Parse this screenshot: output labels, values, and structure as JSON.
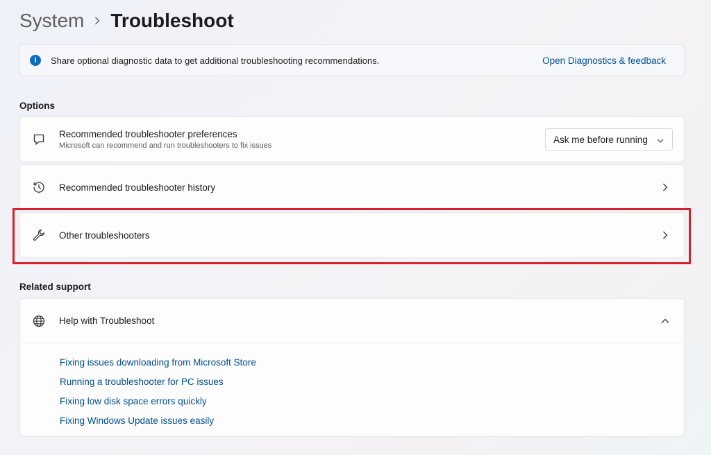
{
  "breadcrumb": {
    "parent": "System",
    "current": "Troubleshoot"
  },
  "info": {
    "text": "Share optional diagnostic data to get additional troubleshooting recommendations.",
    "link": "Open Diagnostics & feedback"
  },
  "options": {
    "title": "Options",
    "preferences": {
      "title": "Recommended troubleshooter preferences",
      "subtitle": "Microsoft can recommend and run troubleshooters to fix issues",
      "dropdown_value": "Ask me before running",
      "icon": "chat-bubble-icon"
    },
    "history": {
      "title": "Recommended troubleshooter history",
      "icon": "history-icon"
    },
    "other": {
      "title": "Other troubleshooters",
      "icon": "wrench-icon"
    }
  },
  "related": {
    "title": "Related support",
    "help": {
      "title": "Help with Troubleshoot",
      "icon": "globe-icon",
      "links": [
        "Fixing issues downloading from Microsoft Store",
        "Running a troubleshooter for PC issues",
        "Fixing low disk space errors quickly",
        "Fixing Windows Update issues easily"
      ]
    }
  },
  "colors": {
    "accent": "#0f6cbd",
    "link": "#004e8c",
    "highlight": "#d6202f"
  }
}
